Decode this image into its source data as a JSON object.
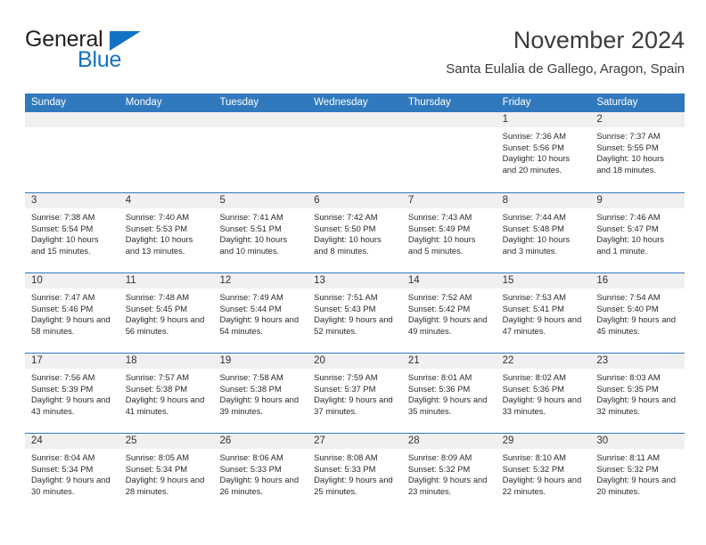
{
  "brand": {
    "name_part1": "General",
    "name_part2": "Blue",
    "accent_color": "#1273c4",
    "flag_icon": "flag-triangle-icon"
  },
  "header": {
    "title": "November 2024",
    "subtitle": "Santa Eulalia de Gallego, Aragon, Spain"
  },
  "calendar": {
    "header_color": "#3179bd",
    "daynum_band_color": "#f0f0f0",
    "weekdays": [
      "Sunday",
      "Monday",
      "Tuesday",
      "Wednesday",
      "Thursday",
      "Friday",
      "Saturday"
    ],
    "weeks": [
      [
        {
          "day": "",
          "empty": true
        },
        {
          "day": "",
          "empty": true
        },
        {
          "day": "",
          "empty": true
        },
        {
          "day": "",
          "empty": true
        },
        {
          "day": "",
          "empty": true
        },
        {
          "day": "1",
          "sunrise": "Sunrise: 7:36 AM",
          "sunset": "Sunset: 5:56 PM",
          "daylight": "Daylight: 10 hours and 20 minutes."
        },
        {
          "day": "2",
          "sunrise": "Sunrise: 7:37 AM",
          "sunset": "Sunset: 5:55 PM",
          "daylight": "Daylight: 10 hours and 18 minutes."
        }
      ],
      [
        {
          "day": "3",
          "sunrise": "Sunrise: 7:38 AM",
          "sunset": "Sunset: 5:54 PM",
          "daylight": "Daylight: 10 hours and 15 minutes."
        },
        {
          "day": "4",
          "sunrise": "Sunrise: 7:40 AM",
          "sunset": "Sunset: 5:53 PM",
          "daylight": "Daylight: 10 hours and 13 minutes."
        },
        {
          "day": "5",
          "sunrise": "Sunrise: 7:41 AM",
          "sunset": "Sunset: 5:51 PM",
          "daylight": "Daylight: 10 hours and 10 minutes."
        },
        {
          "day": "6",
          "sunrise": "Sunrise: 7:42 AM",
          "sunset": "Sunset: 5:50 PM",
          "daylight": "Daylight: 10 hours and 8 minutes."
        },
        {
          "day": "7",
          "sunrise": "Sunrise: 7:43 AM",
          "sunset": "Sunset: 5:49 PM",
          "daylight": "Daylight: 10 hours and 5 minutes."
        },
        {
          "day": "8",
          "sunrise": "Sunrise: 7:44 AM",
          "sunset": "Sunset: 5:48 PM",
          "daylight": "Daylight: 10 hours and 3 minutes."
        },
        {
          "day": "9",
          "sunrise": "Sunrise: 7:46 AM",
          "sunset": "Sunset: 5:47 PM",
          "daylight": "Daylight: 10 hours and 1 minute."
        }
      ],
      [
        {
          "day": "10",
          "sunrise": "Sunrise: 7:47 AM",
          "sunset": "Sunset: 5:46 PM",
          "daylight": "Daylight: 9 hours and 58 minutes."
        },
        {
          "day": "11",
          "sunrise": "Sunrise: 7:48 AM",
          "sunset": "Sunset: 5:45 PM",
          "daylight": "Daylight: 9 hours and 56 minutes."
        },
        {
          "day": "12",
          "sunrise": "Sunrise: 7:49 AM",
          "sunset": "Sunset: 5:44 PM",
          "daylight": "Daylight: 9 hours and 54 minutes."
        },
        {
          "day": "13",
          "sunrise": "Sunrise: 7:51 AM",
          "sunset": "Sunset: 5:43 PM",
          "daylight": "Daylight: 9 hours and 52 minutes."
        },
        {
          "day": "14",
          "sunrise": "Sunrise: 7:52 AM",
          "sunset": "Sunset: 5:42 PM",
          "daylight": "Daylight: 9 hours and 49 minutes."
        },
        {
          "day": "15",
          "sunrise": "Sunrise: 7:53 AM",
          "sunset": "Sunset: 5:41 PM",
          "daylight": "Daylight: 9 hours and 47 minutes."
        },
        {
          "day": "16",
          "sunrise": "Sunrise: 7:54 AM",
          "sunset": "Sunset: 5:40 PM",
          "daylight": "Daylight: 9 hours and 45 minutes."
        }
      ],
      [
        {
          "day": "17",
          "sunrise": "Sunrise: 7:56 AM",
          "sunset": "Sunset: 5:39 PM",
          "daylight": "Daylight: 9 hours and 43 minutes."
        },
        {
          "day": "18",
          "sunrise": "Sunrise: 7:57 AM",
          "sunset": "Sunset: 5:38 PM",
          "daylight": "Daylight: 9 hours and 41 minutes."
        },
        {
          "day": "19",
          "sunrise": "Sunrise: 7:58 AM",
          "sunset": "Sunset: 5:38 PM",
          "daylight": "Daylight: 9 hours and 39 minutes."
        },
        {
          "day": "20",
          "sunrise": "Sunrise: 7:59 AM",
          "sunset": "Sunset: 5:37 PM",
          "daylight": "Daylight: 9 hours and 37 minutes."
        },
        {
          "day": "21",
          "sunrise": "Sunrise: 8:01 AM",
          "sunset": "Sunset: 5:36 PM",
          "daylight": "Daylight: 9 hours and 35 minutes."
        },
        {
          "day": "22",
          "sunrise": "Sunrise: 8:02 AM",
          "sunset": "Sunset: 5:36 PM",
          "daylight": "Daylight: 9 hours and 33 minutes."
        },
        {
          "day": "23",
          "sunrise": "Sunrise: 8:03 AM",
          "sunset": "Sunset: 5:35 PM",
          "daylight": "Daylight: 9 hours and 32 minutes."
        }
      ],
      [
        {
          "day": "24",
          "sunrise": "Sunrise: 8:04 AM",
          "sunset": "Sunset: 5:34 PM",
          "daylight": "Daylight: 9 hours and 30 minutes."
        },
        {
          "day": "25",
          "sunrise": "Sunrise: 8:05 AM",
          "sunset": "Sunset: 5:34 PM",
          "daylight": "Daylight: 9 hours and 28 minutes."
        },
        {
          "day": "26",
          "sunrise": "Sunrise: 8:06 AM",
          "sunset": "Sunset: 5:33 PM",
          "daylight": "Daylight: 9 hours and 26 minutes."
        },
        {
          "day": "27",
          "sunrise": "Sunrise: 8:08 AM",
          "sunset": "Sunset: 5:33 PM",
          "daylight": "Daylight: 9 hours and 25 minutes."
        },
        {
          "day": "28",
          "sunrise": "Sunrise: 8:09 AM",
          "sunset": "Sunset: 5:32 PM",
          "daylight": "Daylight: 9 hours and 23 minutes."
        },
        {
          "day": "29",
          "sunrise": "Sunrise: 8:10 AM",
          "sunset": "Sunset: 5:32 PM",
          "daylight": "Daylight: 9 hours and 22 minutes."
        },
        {
          "day": "30",
          "sunrise": "Sunrise: 8:11 AM",
          "sunset": "Sunset: 5:32 PM",
          "daylight": "Daylight: 9 hours and 20 minutes."
        }
      ]
    ]
  }
}
